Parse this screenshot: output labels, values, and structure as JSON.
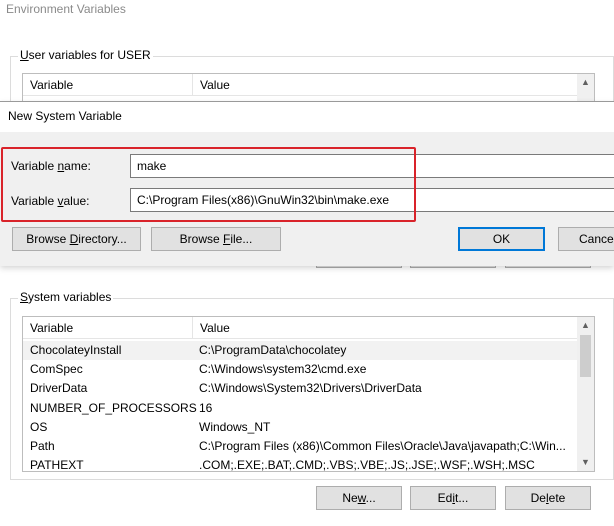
{
  "env_window": {
    "title": "Environment Variables",
    "user_group_label_prefix": "",
    "user_group_label_u": "U",
    "user_group_label_rest": "ser variables for USER",
    "user_list": {
      "col_variable": "Variable",
      "col_value": "Value"
    },
    "system_group_label_u": "S",
    "system_group_label_rest": "ystem variables",
    "system_list": {
      "col_variable": "Variable",
      "col_value": "Value",
      "rows": [
        {
          "variable": "ChocolateyInstall",
          "value": "C:\\ProgramData\\chocolatey"
        },
        {
          "variable": "ComSpec",
          "value": "C:\\Windows\\system32\\cmd.exe"
        },
        {
          "variable": "DriverData",
          "value": "C:\\Windows\\System32\\Drivers\\DriverData"
        },
        {
          "variable": "NUMBER_OF_PROCESSORS",
          "value": "16"
        },
        {
          "variable": "OS",
          "value": "Windows_NT"
        },
        {
          "variable": "Path",
          "value": "C:\\Program Files (x86)\\Common Files\\Oracle\\Java\\javapath;C:\\Win..."
        },
        {
          "variable": "PATHEXT",
          "value": ".COM;.EXE;.BAT;.CMD;.VBS;.VBE;.JS;.JSE;.WSF;.WSH;.MSC"
        }
      ]
    },
    "buttons": {
      "new_pre": "Ne",
      "new_u": "w",
      "new_post": "...",
      "edit_pre": "Ed",
      "edit_u": "i",
      "edit_post": "t...",
      "delete_pre": "De",
      "delete_u": "l",
      "delete_post": "ete"
    }
  },
  "dialog": {
    "title": "New System Variable",
    "name_label_pre": "Variable ",
    "name_label_u": "n",
    "name_label_post": "ame:",
    "name_value": "make",
    "value_label_pre": "Variable ",
    "value_label_u": "v",
    "value_label_post": "alue:",
    "value_value": "C:\\Program Files(x86)\\GnuWin32\\bin\\make.exe",
    "browse_dir_pre": "Browse ",
    "browse_dir_u": "D",
    "browse_dir_post": "irectory...",
    "browse_file_pre": "Browse ",
    "browse_file_u": "F",
    "browse_file_post": "ile...",
    "ok_label": "OK",
    "cancel_label": "Cancel"
  },
  "colors": {
    "highlight": "#d9232a",
    "accent": "#0078d7"
  }
}
